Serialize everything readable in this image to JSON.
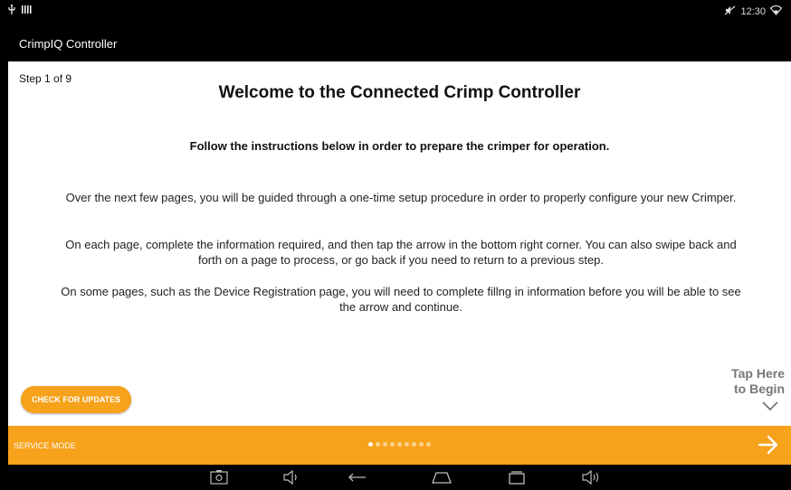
{
  "status_bar": {
    "left_icons": [
      "usb-icon",
      "signal-bars-icon"
    ],
    "right_icons": [
      "mute-icon",
      "wifi-icon"
    ],
    "time": "12:30"
  },
  "app": {
    "title": "CrimpIQ Controller"
  },
  "main": {
    "step": "Step 1 of 9",
    "title": "Welcome to the Connected Crimp Controller",
    "subtitle": "Follow the instructions below in order to prepare the crimper for operation.",
    "paragraphs": [
      "Over the next few pages, you will be guided through a one-time setup procedure in order to properly configure your new Crimper.",
      "On each page, complete the information required, and then tap the arrow in the bottom right corner. You can also swipe back and forth on a page to process, or go back if you need to return to a previous step.",
      "On some pages, such as the Device Registration page, you will need to complete fillng in information before you will be able to see the arrow and continue."
    ],
    "update_button": "CHECK FOR UPDATES",
    "tap_hint_line1": "Tap Here",
    "tap_hint_line2": "to Begin"
  },
  "footer": {
    "service_mode": "SERVICE MODE",
    "page_count": 9,
    "current_page": 1,
    "accent_color": "#f7a21b"
  },
  "nav_bar": {
    "icons": [
      "screenshot-icon",
      "volume-down-icon",
      "back-icon",
      "home-icon",
      "recents-icon",
      "volume-up-icon"
    ]
  }
}
